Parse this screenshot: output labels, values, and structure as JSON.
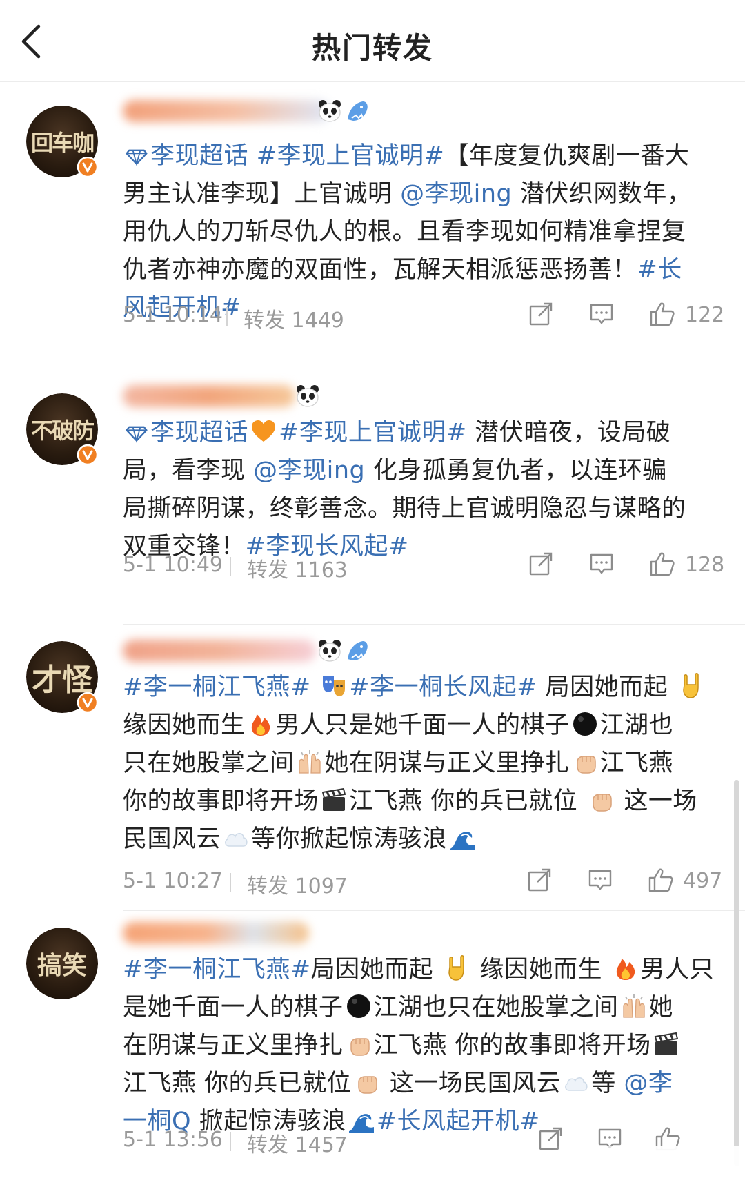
{
  "header": {
    "title": "热门转发",
    "back_icon": "chevron-left-icon"
  },
  "colors": {
    "link": "#3a6fb3",
    "text": "#222222",
    "meta": "#9a9a9a",
    "badge": "#f07f22"
  },
  "posts": [
    {
      "avatar_text": "回车咖",
      "verified": true,
      "line1": {
        "a": "李现超话",
        "b": "#李现上官诚明#",
        "c": "【年度复仇爽剧一番大"
      },
      "line2": {
        "a": "男主认准李现】上官诚明 ",
        "b": "@李现ing",
        "c": " 潜伏织网数年，"
      },
      "line3": "用仇人的刀斩尽仇人的根。且看李现如何精准拿捏复",
      "line4": {
        "a": "仇者亦神亦魔的双面性，瓦解天相派惩恶扬善！",
        "b": "#长"
      },
      "line5": "风起开机#",
      "time": "5-1 10:14",
      "reposts": "转发 1449",
      "likes": "122"
    },
    {
      "avatar_text": "不破防",
      "verified": true,
      "line1": {
        "a": "李现超话",
        "b": "#李现上官诚明#",
        "c": " 潜伏暗夜，设局破"
      },
      "line2": {
        "a": "局，看李现 ",
        "b": "@李现ing",
        "c": "  化身孤勇复仇者，以连环骗"
      },
      "line3": "局撕碎阴谋，终彰善念。期待上官诚明隐忍与谋略的",
      "line4": {
        "a": "双重交锋！",
        "b": "#李现长风起#"
      },
      "time": "5-1 10:49",
      "reposts": "转发 1163",
      "likes": "128"
    },
    {
      "avatar_text": "才怪",
      "verified": true,
      "line1": {
        "a": "#李一桐江飞燕#",
        "b": "#李一桐长风起#",
        "c": " 局因她而起"
      },
      "line2": {
        "a": "缘因她而生",
        "b": "男人只是她千面一人的棋子",
        "c": "江湖也"
      },
      "line3": {
        "a": "只在她股掌之间",
        "b": "她在阴谋与正义里挣扎",
        "c": "江飞燕"
      },
      "line4": {
        "a": "你的故事即将开场",
        "b": "江飞燕 你的兵已就位",
        "c": " 这一场"
      },
      "line5": {
        "a": "民国风云",
        "b": "等你掀起惊涛骇浪"
      },
      "time": "5-1 10:27",
      "reposts": "转发 1097",
      "likes": "497"
    },
    {
      "avatar_text": "搞笑",
      "verified": false,
      "line1": {
        "a": "#李一桐江飞燕#",
        "b": "局因她而起",
        "c": " 缘因她而生",
        "d": "男人只"
      },
      "line2": {
        "a": "是她千面一人的棋子",
        "b": "江湖也只在她股掌之间",
        "c": "她"
      },
      "line3": {
        "a": "在阴谋与正义里挣扎",
        "b": "江飞燕 你的故事即将开场"
      },
      "line4": {
        "a": "江飞燕 你的兵已就位",
        "b": " 这一场民国风云",
        "c": "等 ",
        "d": "@李"
      },
      "line5": {
        "a": "一桐Q",
        "b": " 掀起惊涛骇浪",
        "c": "#长风起开机#"
      },
      "time": "5-1 13:56",
      "reposts": "转发 1457"
    }
  ]
}
